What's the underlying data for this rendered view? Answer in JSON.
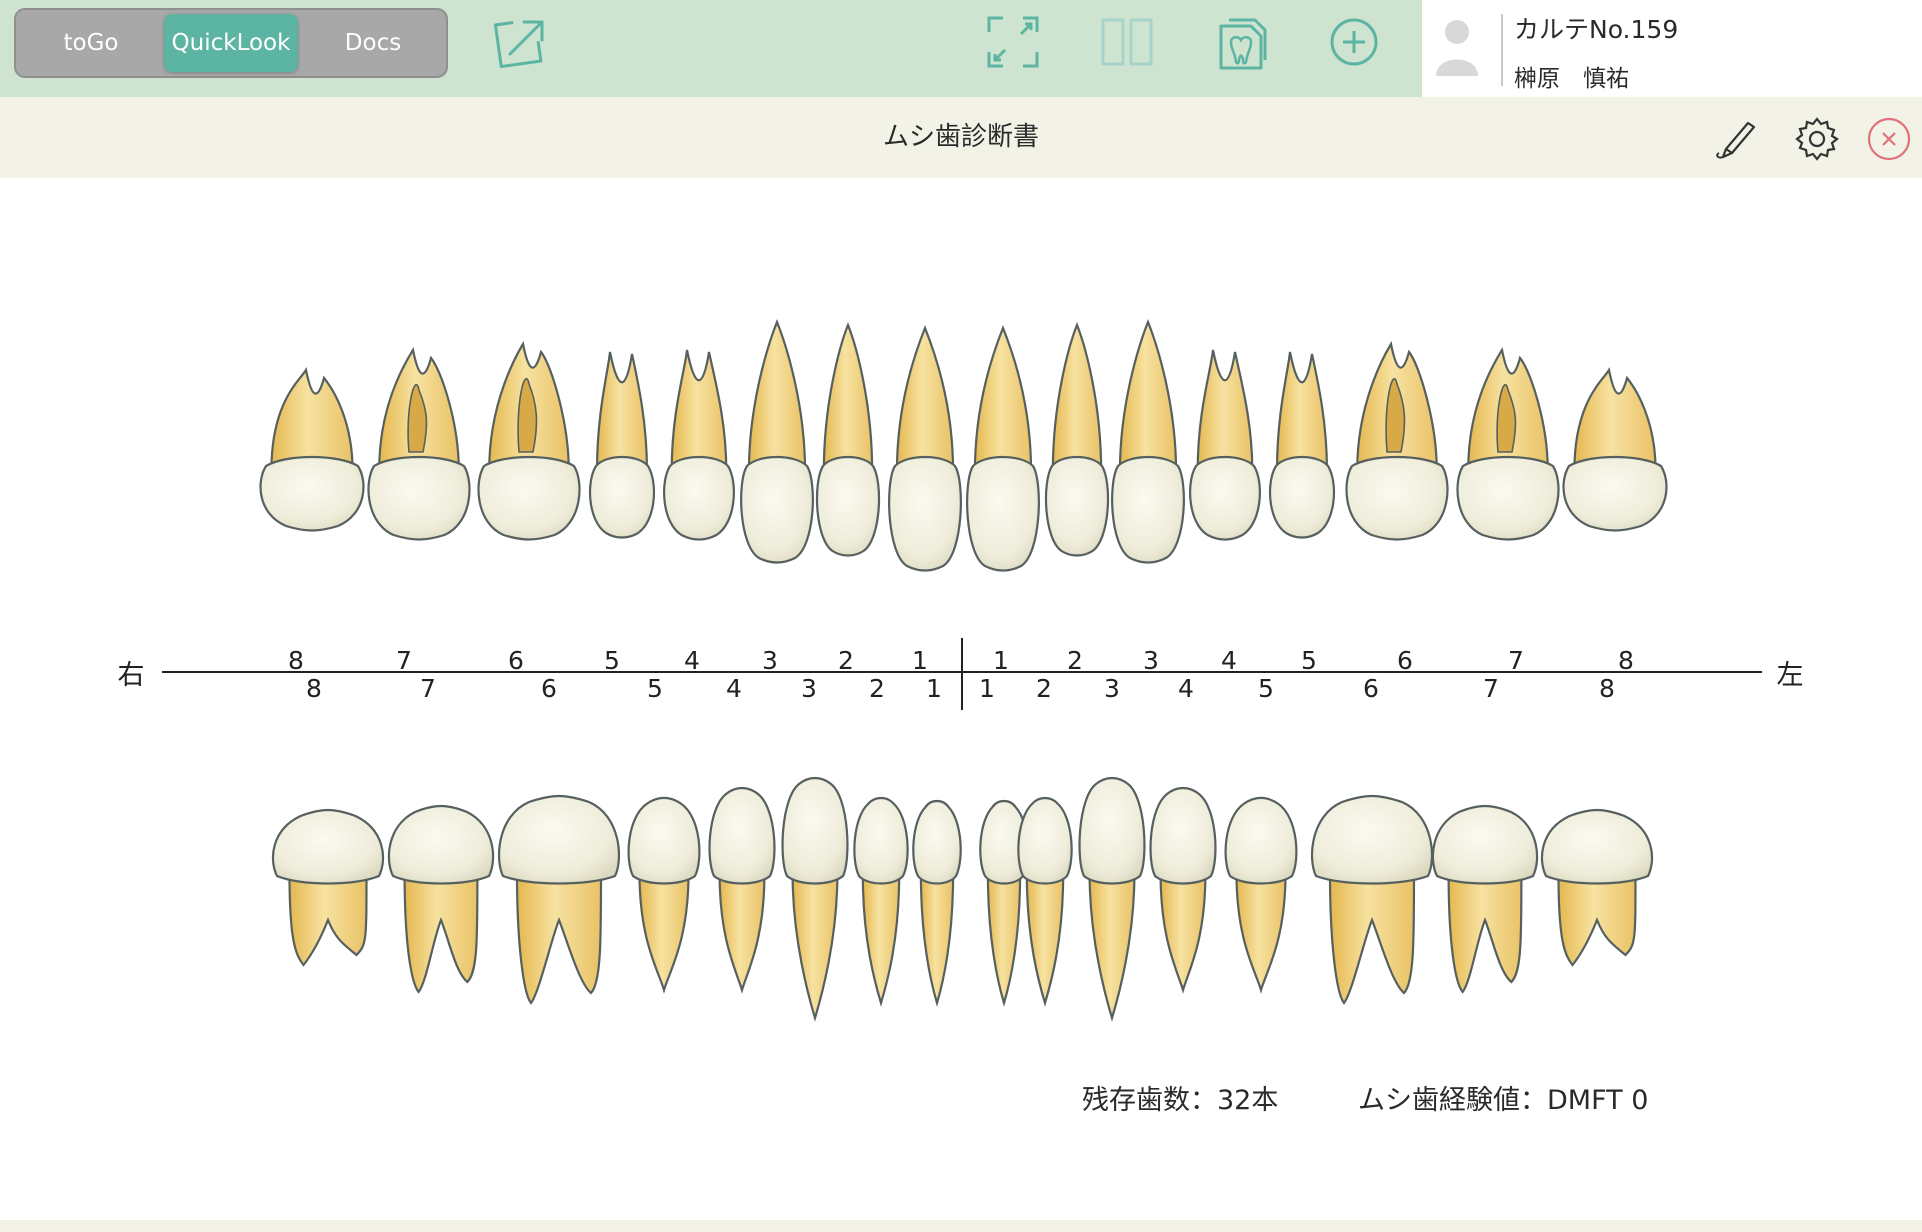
{
  "toolbar": {
    "segments": [
      "toGo",
      "QuickLook",
      "Docs"
    ],
    "selected_segment": "QuickLook",
    "icons": [
      "external-edit-icon",
      "fullscreen-icon",
      "split-view-icon",
      "tooth-document-icon",
      "add-circle-icon"
    ]
  },
  "patient": {
    "chart_number": "カルテNo.159",
    "name": "榊原　慎祐"
  },
  "header": {
    "title": "ムシ歯診断書",
    "icons": [
      "pen-icon",
      "gear-icon",
      "close-icon"
    ]
  },
  "dental_chart": {
    "side_right": "右",
    "side_left": "左",
    "upper_right_numbers": [
      "8",
      "7",
      "6",
      "5",
      "4",
      "3",
      "2",
      "1"
    ],
    "upper_left_numbers": [
      "1",
      "2",
      "3",
      "4",
      "5",
      "6",
      "7",
      "8"
    ],
    "lower_right_numbers": [
      "8",
      "7",
      "6",
      "5",
      "4",
      "3",
      "2",
      "1"
    ],
    "lower_left_numbers": [
      "1",
      "2",
      "3",
      "4",
      "5",
      "6",
      "7",
      "8"
    ]
  },
  "stats": {
    "remaining_teeth": "残存歯数：32本",
    "dmft": "ムシ歯経験値：DMFT 0"
  },
  "colors": {
    "toolbar_bg": "#cfe3d1",
    "header_bg": "#f3f2e6",
    "selected_segment": "#5cb5a3",
    "segment_bg": "#a8a8a8",
    "icon_teal": "#5bb5a2",
    "close_red": "#e0707a",
    "root_yellow": "#f1d37c",
    "crown_ivory": "#f1efde"
  }
}
